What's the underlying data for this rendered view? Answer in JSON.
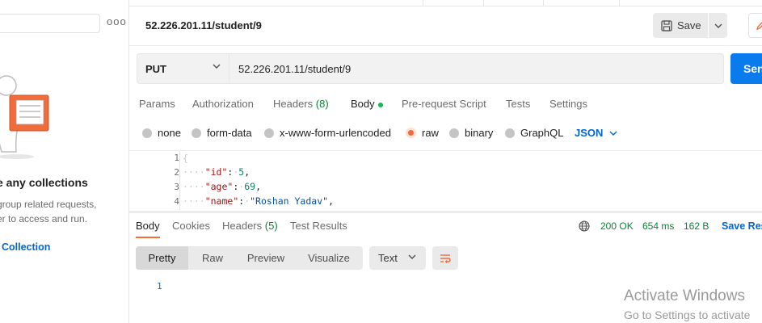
{
  "sidebar": {
    "more_glyph": "ooo",
    "empty_title": "e any collections",
    "empty_desc_line1": "group related requests,",
    "empty_desc_line2": "er to access and run.",
    "create_link": "Collection"
  },
  "request": {
    "title": "52.226.201.11/student/9",
    "save_label": "Save",
    "method": "PUT",
    "url": "52.226.201.11/student/9",
    "send_label": "Send"
  },
  "request_tabs": {
    "params": "Params",
    "authorization": "Authorization",
    "headers": "Headers",
    "headers_count": "(8)",
    "body": "Body",
    "prerequest": "Pre-request Script",
    "tests": "Tests",
    "settings": "Settings"
  },
  "body_types": {
    "none": "none",
    "form_data": "form-data",
    "urlencoded": "x-www-form-urlencoded",
    "raw": "raw",
    "binary": "binary",
    "graphql": "GraphQL",
    "language": "JSON"
  },
  "editor": {
    "line_numbers": [
      "1",
      "2",
      "3",
      "4"
    ],
    "lines": [
      {
        "key": "\"id\"",
        "value": "5"
      },
      {
        "key": "\"age\"",
        "value": "69"
      },
      {
        "key": "\"name\"",
        "value": "\"Roshan Yadav\""
      }
    ]
  },
  "response": {
    "tabs": {
      "body": "Body",
      "cookies": "Cookies",
      "headers": "Headers",
      "headers_count": "(5)",
      "test_results": "Test Results"
    },
    "status": "200 OK",
    "time": "654 ms",
    "size": "162 B",
    "save_response": "Save Res",
    "views": {
      "pretty": "Pretty",
      "raw": "Raw",
      "preview": "Preview",
      "visualize": "Visualize"
    },
    "format": "Text",
    "body_line_number": "1"
  },
  "watermark": {
    "line1": "Activate Windows",
    "line2": "Go to Settings to activate"
  },
  "colors": {
    "accent": "#f26b3a",
    "send_blue": "#097bed",
    "link_blue": "#0265d2",
    "status_green": "#0d7f35"
  }
}
